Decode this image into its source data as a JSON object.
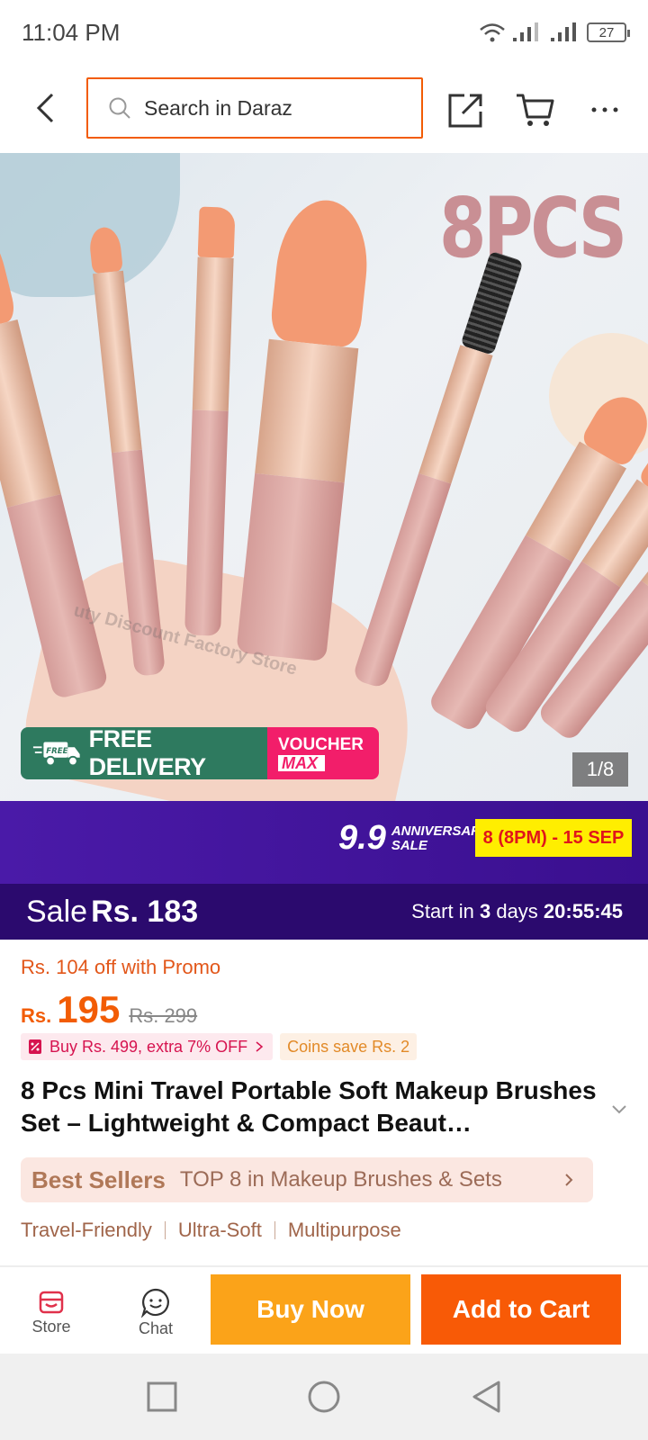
{
  "status_bar": {
    "time": "11:04 PM",
    "battery": "27"
  },
  "search": {
    "placeholder": "Search in Daraz"
  },
  "product_image": {
    "overlay_text": "8PCS",
    "watermark": "uty Discount Factory Store",
    "counter": "1/8",
    "badge_free_small": "FREE",
    "badge_free_delivery": "FREE DELIVERY",
    "badge_voucher": "VOUCHER",
    "badge_max": "MAX"
  },
  "campaign": {
    "big": "9.9",
    "small_line1": "ANNIVERSARY",
    "small_line2": "SALE",
    "dates": "8 (8PM) - 15 SEP",
    "color_bg": "#4a1aa8",
    "color_dates": "#ffee00"
  },
  "sale_bar": {
    "label": "Sale",
    "price": "Rs. 183",
    "countdown_prefix": "Start in ",
    "countdown_days": "3",
    "countdown_days_suffix": " days ",
    "countdown_time": "20:55:45"
  },
  "price": {
    "promo_line": "Rs. 104 off with Promo",
    "currency": "Rs.",
    "value": "195",
    "original": "Rs. 299",
    "accent_color": "#f25c05"
  },
  "chips": {
    "bundle": "Buy Rs. 499, extra 7% OFF",
    "coins": "Coins save Rs. 2"
  },
  "product": {
    "title": "8 Pcs Mini Travel Portable Soft Makeup Brushes Set – Lightweight & Compact Beaut…"
  },
  "bestseller": {
    "label": "Best Sellers",
    "text": "TOP 8 in Makeup Brushes & Sets"
  },
  "tags": [
    "Travel-Friendly",
    "Ultra-Soft",
    "Multipurpose"
  ],
  "action_bar": {
    "store_label": "Store",
    "chat_label": "Chat",
    "buy_now_label": "Buy Now",
    "add_to_cart_label": "Add to Cart",
    "buy_now_color": "#fba319",
    "add_to_cart_color": "#f85a06"
  }
}
